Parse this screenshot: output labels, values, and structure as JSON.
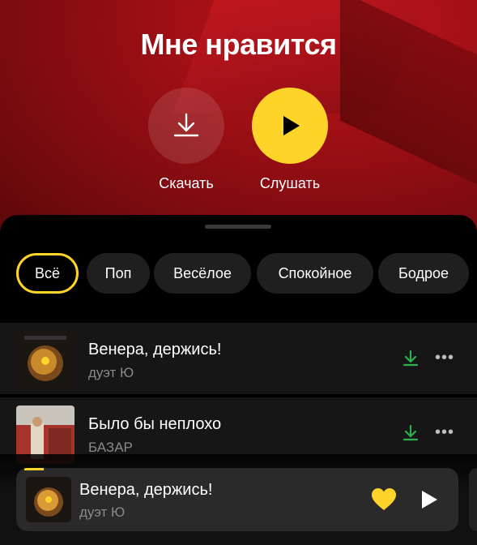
{
  "header": {
    "title": "Мне нравится"
  },
  "actions": {
    "download_label": "Скачать",
    "listen_label": "Слушать"
  },
  "filters": [
    "Всё",
    "Поп",
    "Весёлое",
    "Спокойное",
    "Бодрое"
  ],
  "active_filter": "Всё",
  "tracks": [
    {
      "title": "Венера, держись!",
      "artist": "дуэт Ю",
      "downloaded": true
    },
    {
      "title": "Было бы неплохо",
      "artist": "БАЗАР",
      "downloaded": true
    }
  ],
  "now_playing": {
    "title": "Венера, держись!",
    "artist": "дуэт Ю",
    "liked": true
  },
  "colors": {
    "accent": "#fed42b",
    "hero_red": "#9e0f14",
    "download_green": "#2bb24c"
  }
}
